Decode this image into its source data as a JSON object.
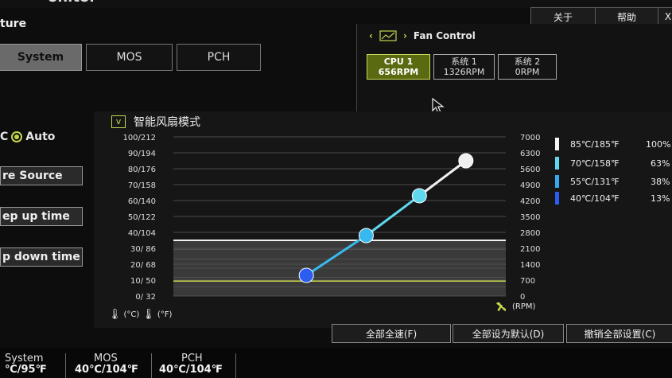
{
  "header": {
    "title_fragment": "onitor",
    "about_label": "关于",
    "help_label": "帮助",
    "close_label": "X"
  },
  "left": {
    "section_label": "ture",
    "tabs": [
      "System",
      "MOS",
      "PCH"
    ],
    "mode": {
      "manual_fragment": "C",
      "auto_label": "Auto"
    },
    "buttons": [
      "re Source",
      "ep up time",
      "p down time"
    ]
  },
  "fan_control": {
    "title": "Fan Control",
    "fans": [
      {
        "name": "CPU 1",
        "rpm": "656RPM",
        "active": true
      },
      {
        "name": "系统 1",
        "rpm": "1326RPM",
        "active": false
      },
      {
        "name": "系统 2",
        "rpm": "0RPM",
        "active": false
      }
    ]
  },
  "smart_mode": {
    "checked": true,
    "check_mark": "v",
    "label": "智能风扇模式"
  },
  "chart_data": {
    "type": "line",
    "y_left_ticks": [
      "100/212",
      "90/194",
      "80/176",
      "70/158",
      "60/140",
      "50/122",
      "40/104",
      "30/ 86",
      "20/ 68",
      "10/ 50",
      "0/ 32"
    ],
    "y_right_ticks": [
      "7000",
      "6300",
      "5600",
      "4900",
      "4200",
      "3500",
      "2800",
      "2100",
      "1400",
      "700",
      "0"
    ],
    "units_left": [
      "(°C)",
      "(°F)"
    ],
    "units_right": "(RPM)",
    "ylim_temp_c": [
      0,
      100
    ],
    "ylim_rpm": [
      0,
      7000
    ],
    "current_temp_c": 35,
    "current_rpm": 656,
    "points": [
      {
        "x_pct": 0.4,
        "y_pct": 0.13,
        "color": "#2a5df0"
      },
      {
        "x_pct": 0.58,
        "y_pct": 0.38,
        "color": "#38b8ee"
      },
      {
        "x_pct": 0.74,
        "y_pct": 0.63,
        "color": "#5fd8ee"
      },
      {
        "x_pct": 0.88,
        "y_pct": 0.85,
        "color": "#f0f0f0"
      }
    ],
    "legend": [
      {
        "label": "85℃/185℉",
        "pct": "100%",
        "color": "#f5f5f5"
      },
      {
        "label": "70℃/158℉",
        "pct": "63%",
        "color": "#5fd8ee"
      },
      {
        "label": "55℃/131℉",
        "pct": "38%",
        "color": "#38a8ee"
      },
      {
        "label": "40℃/104℉",
        "pct": "13%",
        "color": "#2a5df0"
      }
    ],
    "grid": true
  },
  "actions": [
    "全部全速(F)",
    "全部设为默认(D)",
    "撤销全部设置(C)"
  ],
  "temps": [
    {
      "label": "System",
      "value": "℃/95℉"
    },
    {
      "label": "MOS",
      "value": "40℃/104℉"
    },
    {
      "label": "PCH",
      "value": "40℃/104℉"
    }
  ]
}
